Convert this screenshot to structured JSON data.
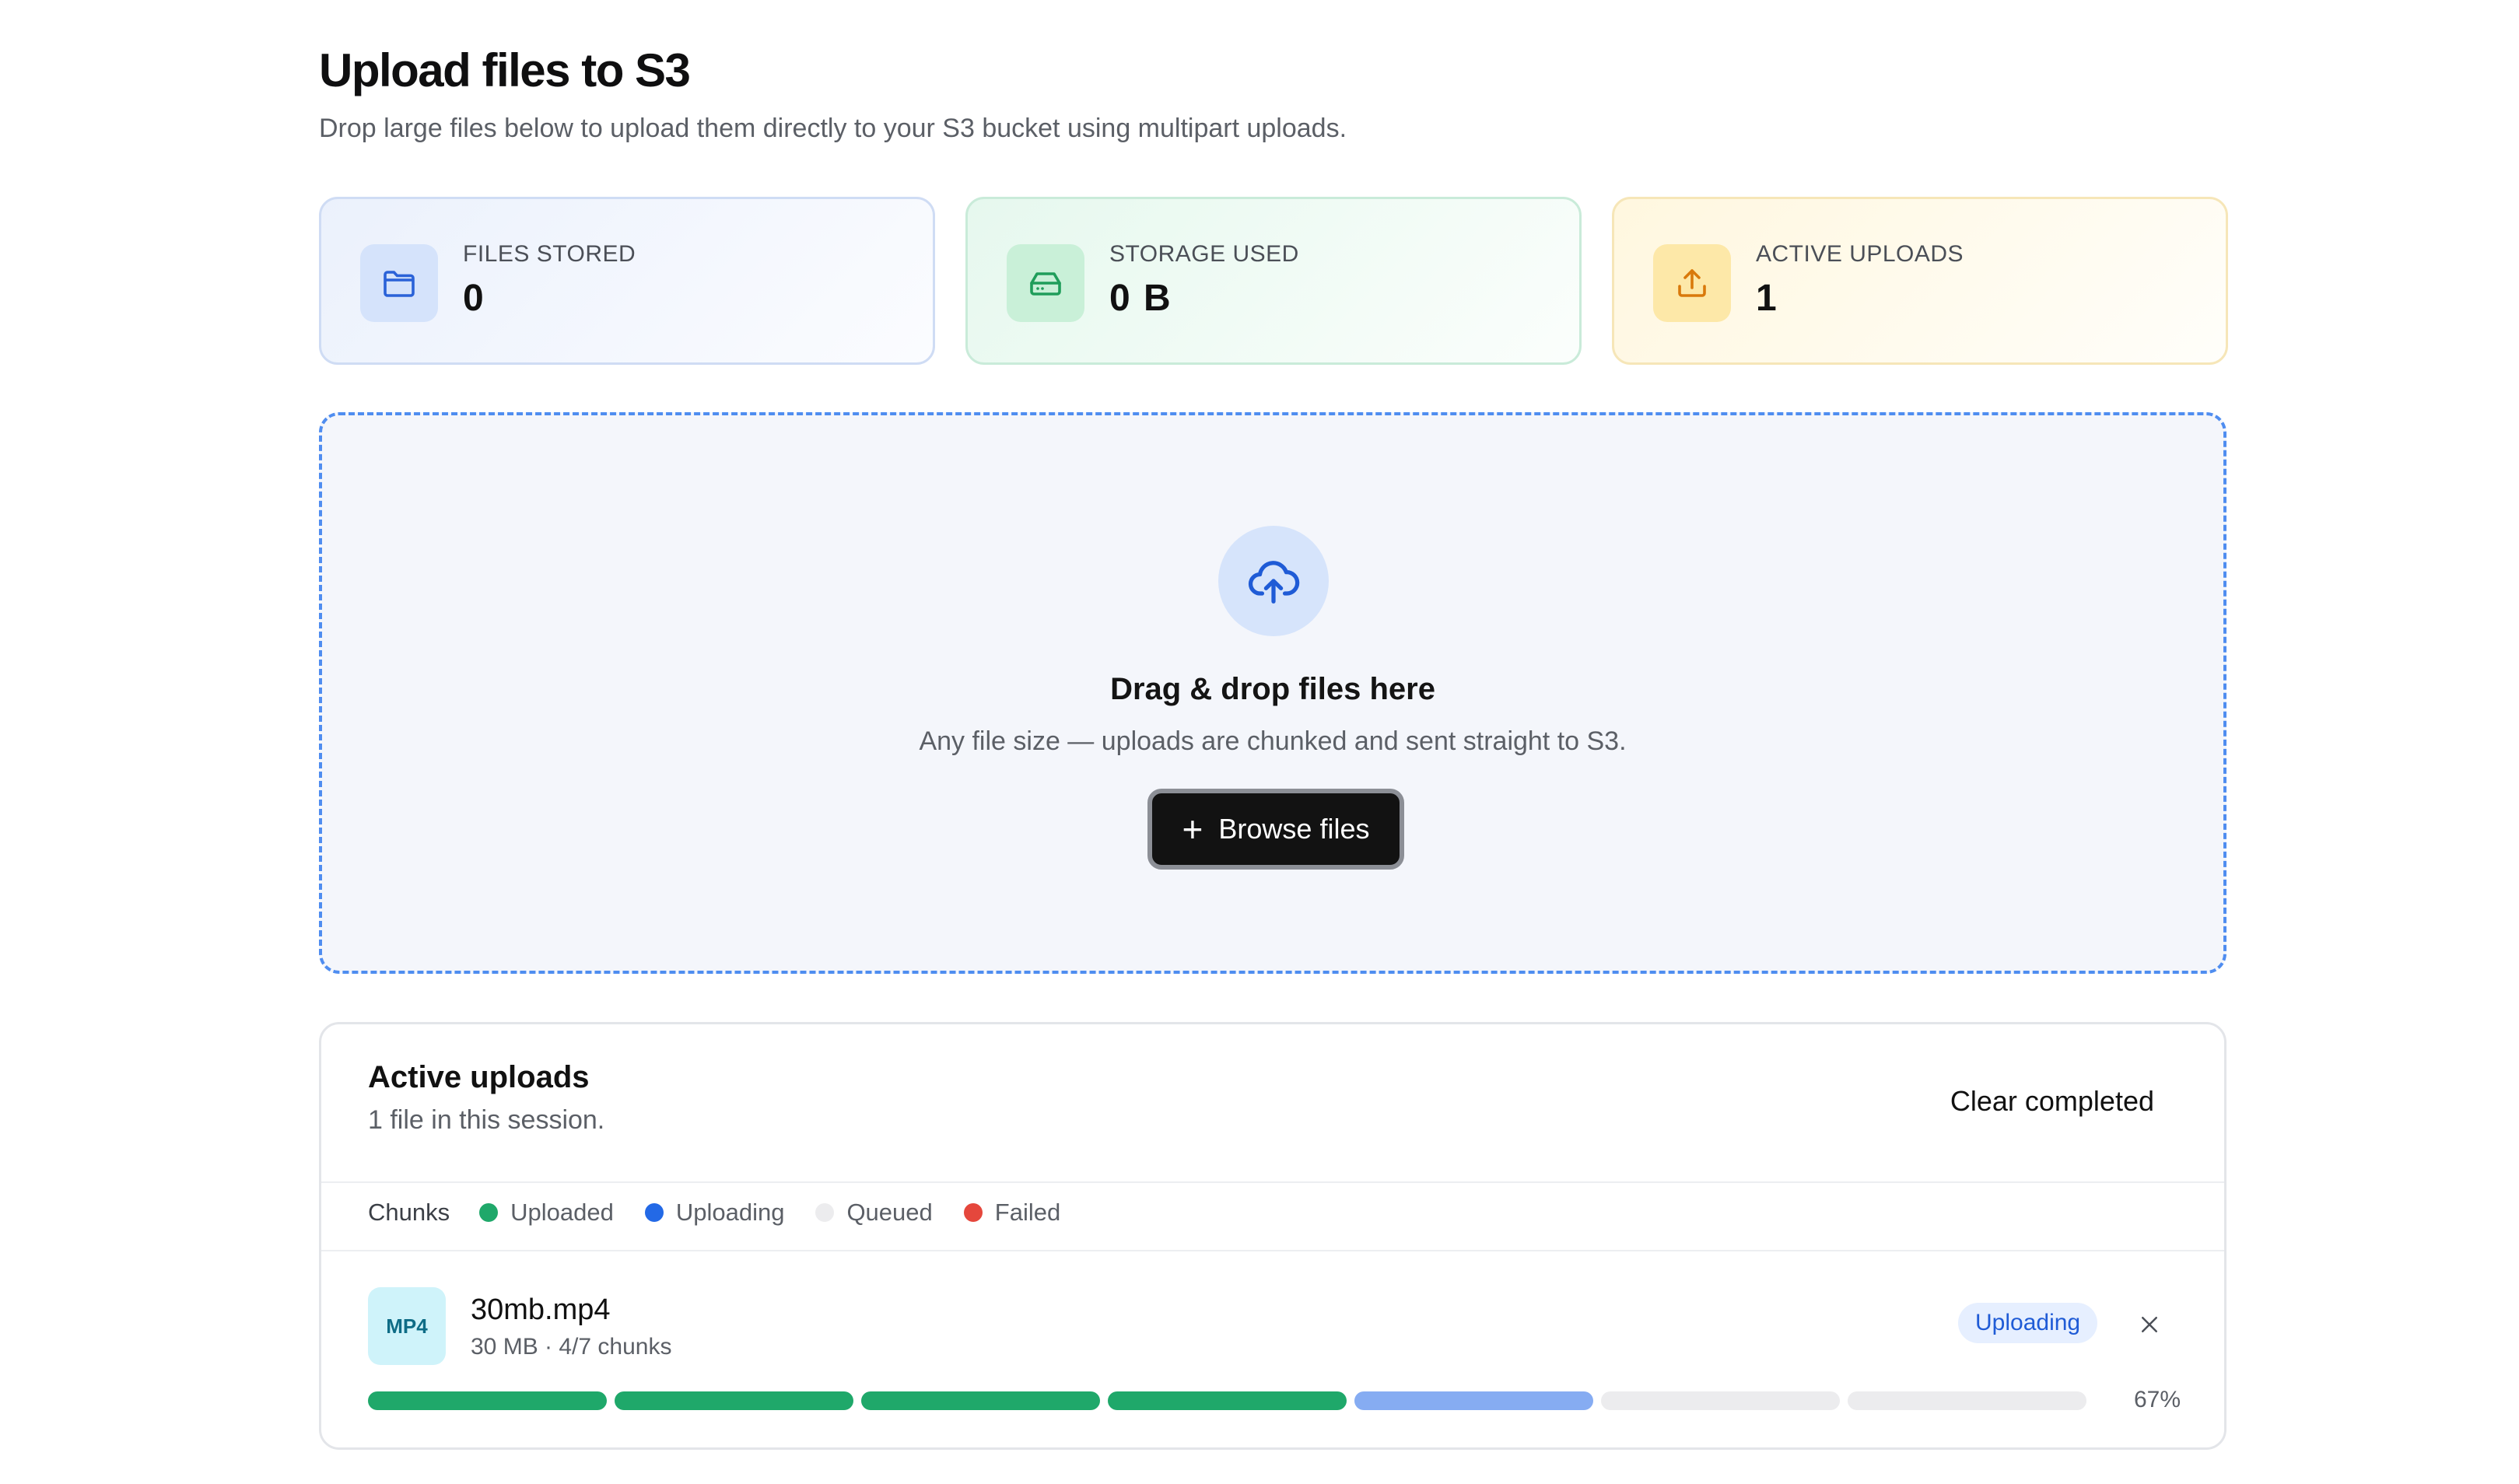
{
  "header": {
    "title": "Upload files to S3",
    "subtitle": "Drop large files below to upload them directly to your S3 bucket using multipart uploads."
  },
  "stats": [
    {
      "label": "FILES STORED",
      "value": "0",
      "icon": "folder-icon",
      "color": "#2a62d8"
    },
    {
      "label": "STORAGE USED",
      "value": "0 B",
      "icon": "hard-drive-icon",
      "color": "#1f9d5a"
    },
    {
      "label": "ACTIVE UPLOADS",
      "value": "1",
      "icon": "upload-icon",
      "color": "#d9790b"
    }
  ],
  "dropzone": {
    "icon": "cloud-upload-icon",
    "title": "Drag & drop files here",
    "subtitle": "Any file size — uploads are chunked and sent straight to S3.",
    "browse_label": "Browse files",
    "browse_icon": "plus-icon"
  },
  "uploads": {
    "title": "Active uploads",
    "subtitle": "1 file in this session.",
    "clear_label": "Clear completed",
    "legend": {
      "title": "Chunks",
      "items": [
        {
          "label": "Uploaded",
          "color": "#1fa86a"
        },
        {
          "label": "Uploading",
          "color": "#2369e6"
        },
        {
          "label": "Queued",
          "color": "#ececee"
        },
        {
          "label": "Failed",
          "color": "#e5473c"
        }
      ]
    },
    "files": [
      {
        "badge": "MP4",
        "name": "30mb.mp4",
        "meta": "30 MB · 4/7 chunks",
        "status": "Uploading",
        "close_icon": "close-icon",
        "percent": "67%",
        "chunks": [
          "uploaded",
          "uploaded",
          "uploaded",
          "uploaded",
          "uploading",
          "queued",
          "queued"
        ]
      }
    ]
  },
  "chunk_colors": {
    "uploaded": "#1fa86a",
    "uploading": "#86acf2",
    "queued": "#ececee",
    "failed": "#e5473c"
  }
}
